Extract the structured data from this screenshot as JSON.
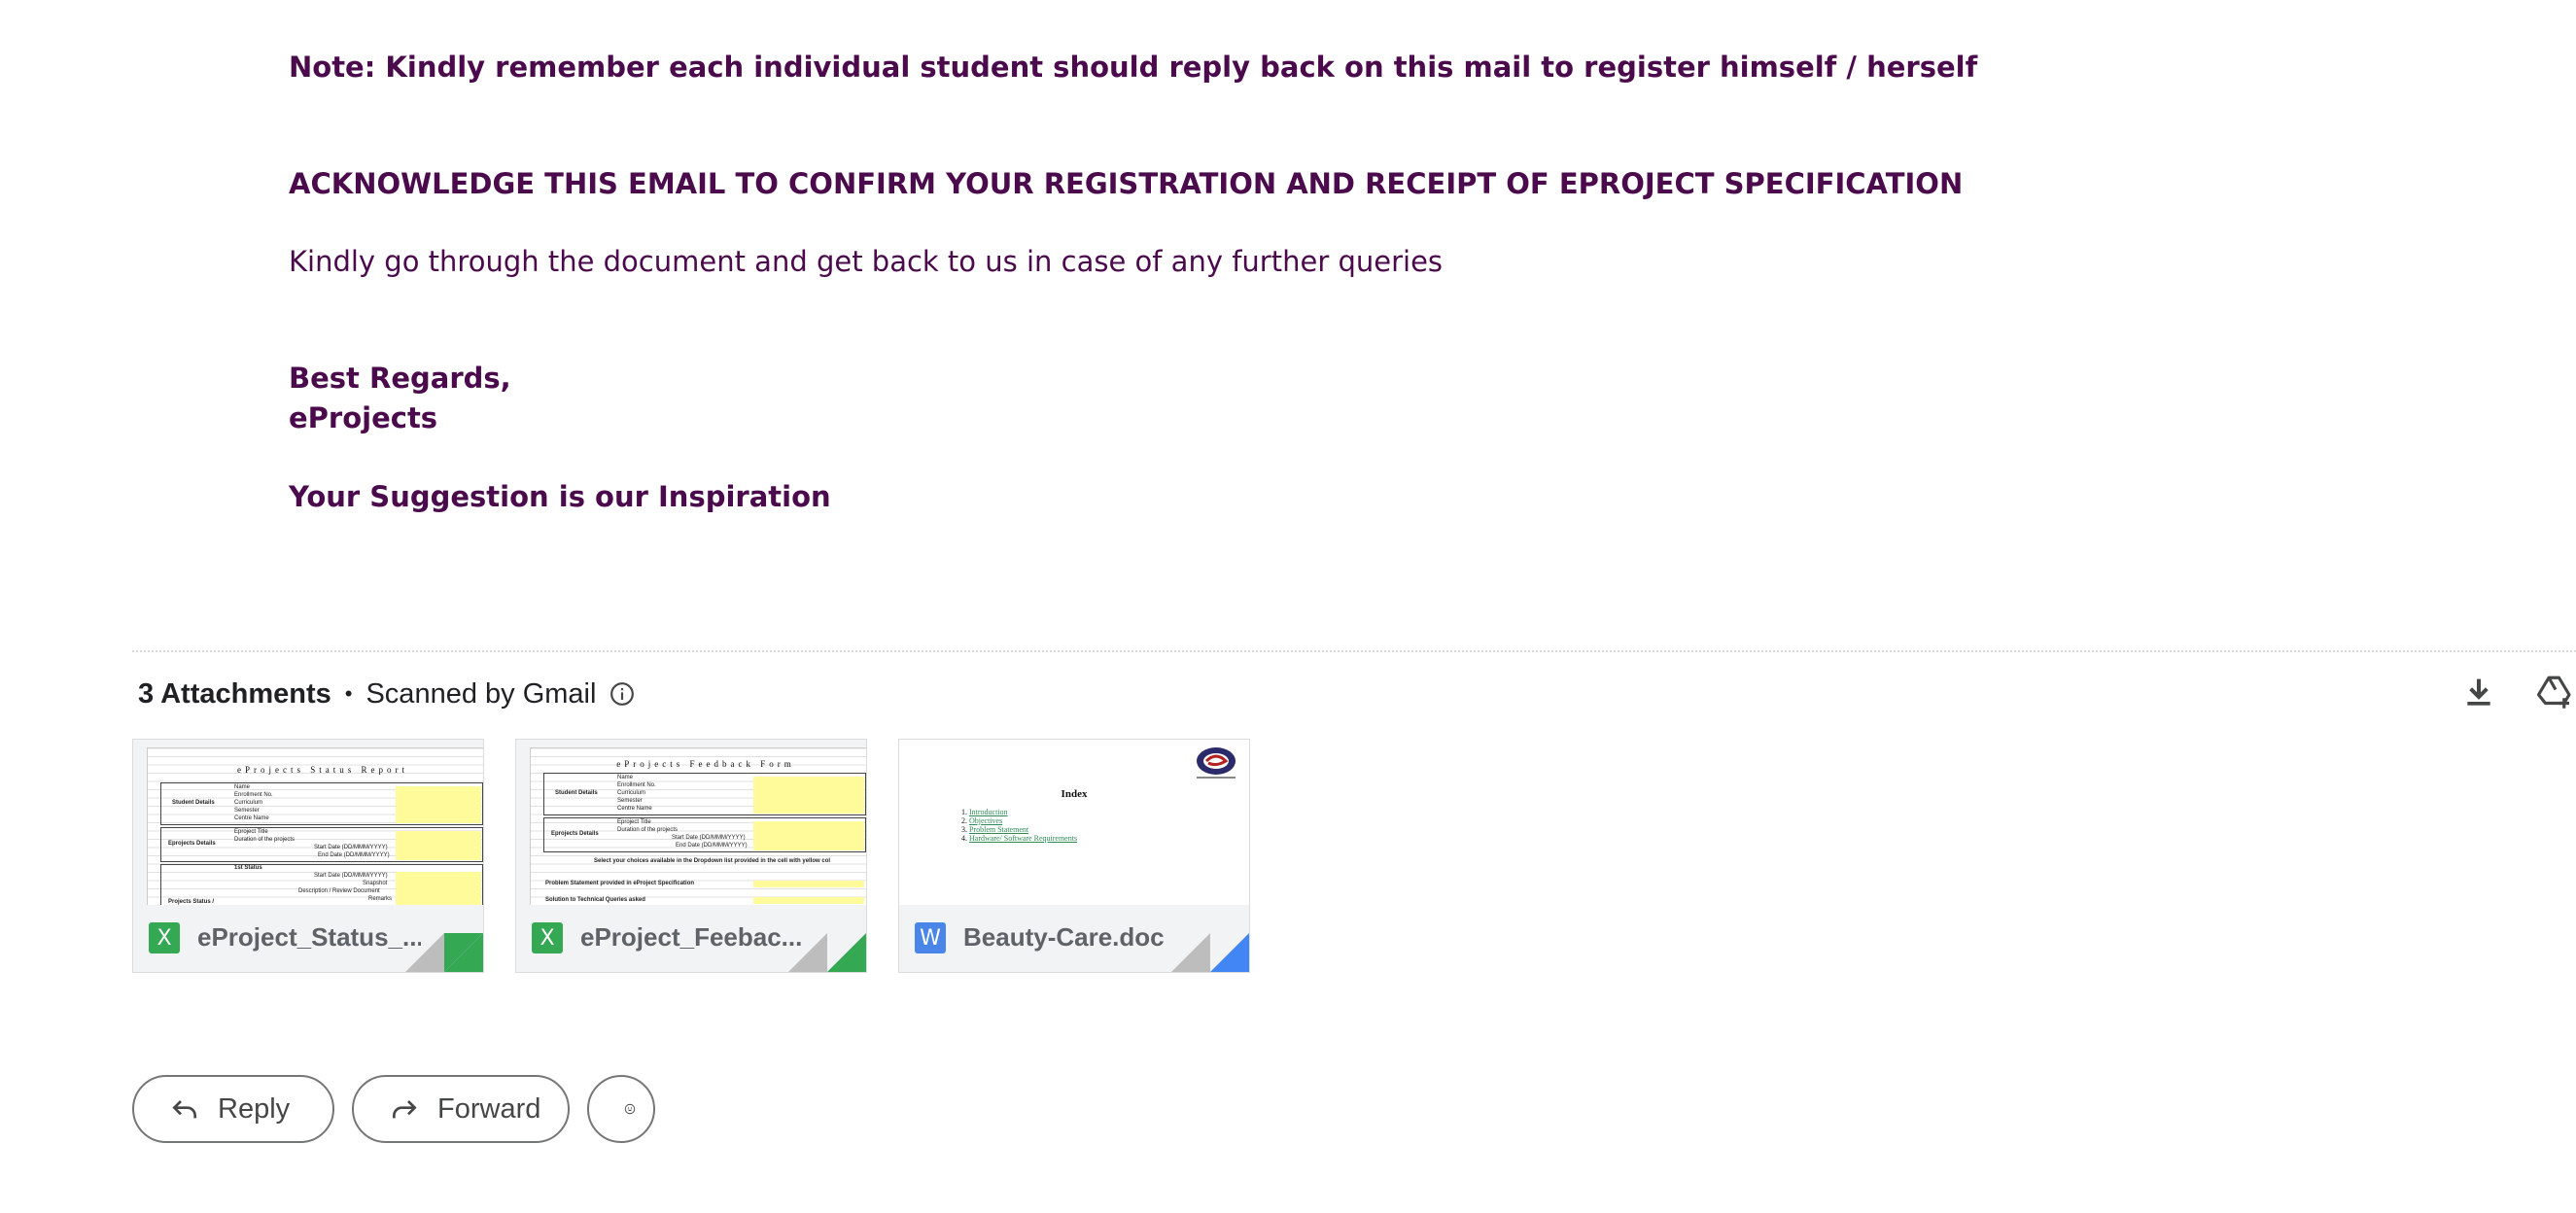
{
  "body": {
    "note": "Note: Kindly remember each individual student should reply back on this mail to register himself / herself",
    "acknowledge": "ACKNOWLEDGE THIS EMAIL TO CONFIRM YOUR REGISTRATION AND RECEIPT OF EPROJECT SPECIFICATION",
    "kindly": "Kindly go through the document and get back to us in case of any further queries",
    "regards": "Best Regards,",
    "org": "eProjects",
    "suggestion": "Your Suggestion is our Inspiration"
  },
  "attachments": {
    "count_label": "3 Attachments",
    "separator": "•",
    "scanned_label": "Scanned by Gmail",
    "items": [
      {
        "name": "eProject_Status_...",
        "badge": "X",
        "badge_color": "#34a853",
        "fold_color": "#34a853",
        "preview": {
          "title": "eProjects Status Report",
          "section1": "Student Details",
          "section2": "Eprojects Details",
          "section3": "Projects Status /",
          "fields1": [
            "Name",
            "Enrollment No.",
            "Curriculum",
            "Semester",
            "Centre Name"
          ],
          "fields2": [
            "Eproject Title",
            "Duration of the projects",
            "Start Date (DD/MMM/YYYY)",
            "End Date (DD/MMM/YYYY)"
          ],
          "fields3": [
            "1st Status",
            "Start Date (DD/MMM/YYYY)",
            "Snapshot",
            "Description / Review Document",
            "Remarks"
          ]
        }
      },
      {
        "name": "eProject_Feebac...",
        "badge": "X",
        "badge_color": "#34a853",
        "fold_color": "#34a853",
        "preview": {
          "title": "eProjects Feedback Form",
          "section1": "Student Details",
          "section2": "Eprojects Details",
          "fields1": [
            "Name",
            "Enrollment No.",
            "Curriculum",
            "Semester",
            "Centre Name"
          ],
          "fields2": [
            "Eproject Title",
            "Duration of the projects",
            "Start Date (DD/MMM/YYYY)",
            "End Date (DD/MMM/YYYY)"
          ],
          "choices": "Select your choices available in the Dropdown list provided in the cell with yellow col",
          "q1": "Problem Statement provided in eProject Specification",
          "q2": "Solution to Technical Queries asked"
        }
      },
      {
        "name": "Beauty-Care.doc",
        "badge": "W",
        "badge_color": "#4a86e8",
        "fold_color": "#4285f4",
        "preview": {
          "title": "Index",
          "items": [
            "Introduction",
            "Objectives",
            "Problem Statement",
            "Hardware/ Software Requirements"
          ]
        }
      }
    ]
  },
  "actions": {
    "reply": "Reply",
    "forward": "Forward"
  },
  "icons": {
    "info": "info-icon",
    "download": "download-icon",
    "drive": "add-to-drive-icon",
    "reply": "reply-arrow-icon",
    "forward": "forward-arrow-icon",
    "emoji": "emoji-smiley-icon"
  }
}
